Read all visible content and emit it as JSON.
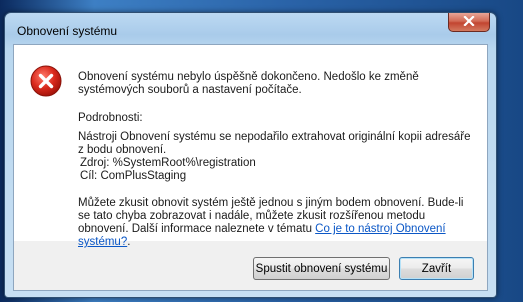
{
  "window": {
    "title": "Obnovení systému"
  },
  "dialog": {
    "main_message": "Obnovení systému nebylo úspěšně dokončeno. Nedošlo ke změně systémových souborů a nastavení počítače.",
    "details_heading": "Podrobnosti:",
    "details_line1": "Nástroji Obnovení systému se nepodařilo extrahovat originální kopii adresáře z bodu obnovení.",
    "source_line": "Zdroj: %SystemRoot%\\registration",
    "target_line": "Cíl: ComPlusStaging",
    "advice_text": "Můžete zkusit obnovit systém ještě jednou s jiným bodem obnovení. Bude-li se tato chyba zobrazovat i nadále, můžete zkusit rozšířenou metodu obnovení. Další informace naleznete v tématu",
    "help_link": "Co je to nástroj Obnovení systému?",
    "link_suffix": "."
  },
  "buttons": {
    "run_restore": "Spustit obnovení systému",
    "close": "Zavřít"
  },
  "icons": {
    "error": "error-icon",
    "close": "close-icon"
  }
}
